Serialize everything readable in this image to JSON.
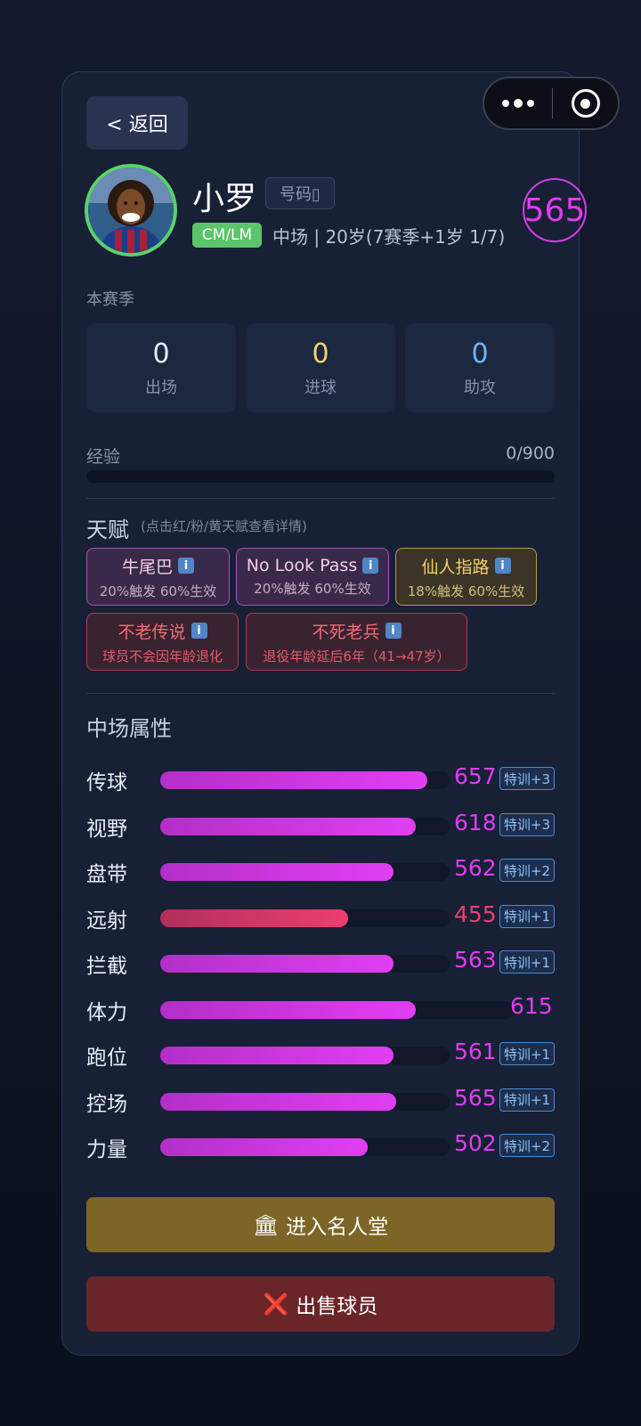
{
  "header": {
    "back_label": "< 返回"
  },
  "player": {
    "name": "小罗",
    "number_tag": "号码▯",
    "position_badge": "CM/LM",
    "position_info": "中场 | 20岁(7赛季+1岁 1/7)",
    "rating": "565"
  },
  "season": {
    "label": "本赛季",
    "stats": [
      {
        "value": "0",
        "label": "出场",
        "color": "#e8ecf5"
      },
      {
        "value": "0",
        "label": "进球",
        "color": "#f1d26b"
      },
      {
        "value": "0",
        "label": "助攻",
        "color": "#6fb6f2"
      }
    ]
  },
  "experience": {
    "label": "经验",
    "value": "0/900",
    "progress": 0.0
  },
  "talents": {
    "title": "天赋",
    "hint": "(点击红/粉/黄天赋查看详情)",
    "info_glyph": "i",
    "items": [
      {
        "name": "牛尾巴",
        "desc": "20%触发 60%生效",
        "tier": "pink"
      },
      {
        "name": "No Look Pass",
        "desc": "20%触发 60%生效",
        "tier": "pink"
      },
      {
        "name": "仙人指路",
        "desc": "18%触发 60%生效",
        "tier": "gold"
      },
      {
        "name": "不老传说",
        "desc": "球员不会因年龄退化",
        "tier": "red"
      },
      {
        "name": "不死老兵",
        "desc": "退役年龄延后6年（41→47岁）",
        "tier": "red"
      }
    ]
  },
  "attributes": {
    "title": "中场属性",
    "items": [
      {
        "label": "传球",
        "value": "657",
        "train": "特训+3",
        "fill": 0.94
      },
      {
        "label": "视野",
        "value": "618",
        "train": "特训+3",
        "fill": 0.9
      },
      {
        "label": "盘带",
        "value": "562",
        "train": "特训+2",
        "fill": 0.82
      },
      {
        "label": "远射",
        "value": "455",
        "train": "特训+1",
        "fill": 0.66,
        "accent": "red"
      },
      {
        "label": "拦截",
        "value": "563",
        "train": "特训+1",
        "fill": 0.82
      },
      {
        "label": "体力",
        "value": "615",
        "train": "",
        "fill": 0.9
      },
      {
        "label": "跑位",
        "value": "561",
        "train": "特训+1",
        "fill": 0.82
      },
      {
        "label": "控场",
        "value": "565",
        "train": "特训+1",
        "fill": 0.83
      },
      {
        "label": "力量",
        "value": "502",
        "train": "特训+2",
        "fill": 0.73
      }
    ]
  },
  "actions": {
    "hall_of_fame": "进入名人堂",
    "hall_icon": "🏛",
    "sell": "出售球员",
    "sell_icon": "❌"
  },
  "colors": {
    "accent_magenta": "#e03cf0",
    "success_green": "#5cc46a",
    "gold": "#7c6526",
    "danger": "#6a2528"
  }
}
